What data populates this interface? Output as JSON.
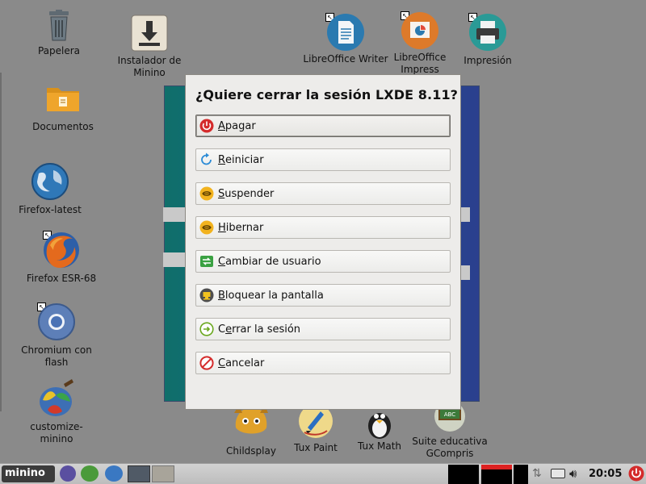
{
  "desktop": {
    "icons": {
      "trash": "Papelera",
      "installer_line1": "Instalador de",
      "installer_line2": "Minino",
      "documents": "Documentos",
      "firefox_latest": "Firefox-latest",
      "firefox_esr": "Firefox ESR-68",
      "chromium_line1": "Chromium con",
      "chromium_line2": "flash",
      "customize_line1": "customize-",
      "customize_line2": "minino",
      "lo_writer": "LibreOffice Writer",
      "lo_impress_line1": "LibreOffice",
      "lo_impress_line2": "Impress",
      "printing": "Impresión",
      "childsplay": "Childsplay",
      "tuxpaint": "Tux Paint",
      "tuxmath": "Tux Math",
      "gcompris_line1": "Suite educativa",
      "gcompris_line2": "GCompris"
    }
  },
  "dialog": {
    "title": "¿Quiere cerrar la sesión LXDE 8.11?",
    "options": [
      {
        "mnemonic": "A",
        "rest": "pagar",
        "icon": "power-icon"
      },
      {
        "mnemonic": "R",
        "rest": "einiciar",
        "icon": "restart-icon"
      },
      {
        "mnemonic": "S",
        "rest": "uspender",
        "icon": "suspend-icon"
      },
      {
        "mnemonic": "H",
        "rest": "ibernar",
        "icon": "hibernate-icon"
      },
      {
        "mnemonic": "C",
        "rest": "ambiar de usuario",
        "icon": "switch-user-icon"
      },
      {
        "mnemonic": "B",
        "rest": "loquear la pantalla",
        "icon": "lock-screen-icon"
      },
      {
        "pre": "C",
        "mnemonic": "e",
        "rest": "rrar la sesión",
        "icon": "logout-icon"
      },
      {
        "mnemonic": "C",
        "rest": "ancelar",
        "icon": "cancel-icon"
      }
    ]
  },
  "taskbar": {
    "menu_label": "minino",
    "clock": "20:05"
  },
  "colors": {
    "desktop_bg": "#8a8a8a",
    "dialog_bg": "#edecea",
    "power_red": "#d42b2b",
    "taskbar_bg": "#c8c8c8"
  }
}
